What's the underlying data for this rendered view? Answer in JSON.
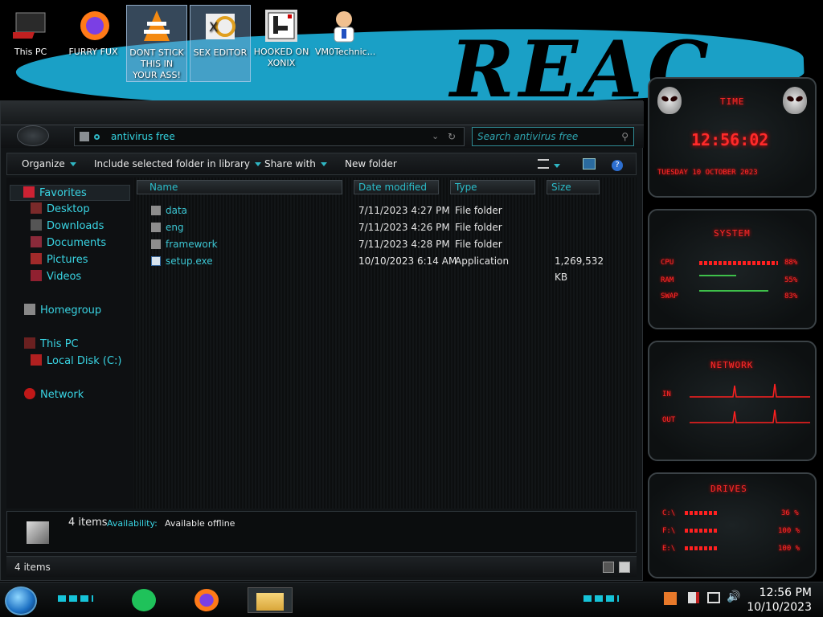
{
  "desktop": {
    "wallpaper_text": "REAC",
    "icons": [
      {
        "label": "This PC"
      },
      {
        "label": "FURRY FUX"
      },
      {
        "label": "DONT STICK THIS IN YOUR ASS!"
      },
      {
        "label": "SEX EDITOR"
      },
      {
        "label": "HOOKED ON XONIX"
      },
      {
        "label": "VM0Technic..."
      }
    ]
  },
  "explorer": {
    "address": "antivirus free",
    "search_placeholder": "Search antivirus free",
    "toolbar": {
      "organize": "Organize",
      "include_library": "Include selected folder in library",
      "share_with": "Share with",
      "new_folder": "New folder"
    },
    "nav": {
      "favorites": "Favorites",
      "desktop": "Desktop",
      "downloads": "Downloads",
      "documents": "Documents",
      "pictures": "Pictures",
      "videos": "Videos",
      "homegroup": "Homegroup",
      "this_pc": "This PC",
      "local_disk": "Local Disk (C:)",
      "network": "Network"
    },
    "columns": {
      "name": "Name",
      "date": "Date modified",
      "type": "Type",
      "size": "Size"
    },
    "files": [
      {
        "name": "data",
        "date": "7/11/2023 4:27 PM",
        "type": "File folder",
        "size": "",
        "icon": "folder-icon"
      },
      {
        "name": "eng",
        "date": "7/11/2023 4:26 PM",
        "type": "File folder",
        "size": "",
        "icon": "folder-icon"
      },
      {
        "name": "framework",
        "date": "7/11/2023 4:28 PM",
        "type": "File folder",
        "size": "",
        "icon": "folder-icon"
      },
      {
        "name": "setup.exe",
        "date": "10/10/2023 6:14 AM",
        "type": "Application",
        "size": "1,269,532 KB",
        "icon": "application-icon"
      }
    ],
    "details": {
      "count": "4 items",
      "availability_label": "Availability:",
      "availability_value": "Available offline"
    },
    "status": "4 items"
  },
  "widgets": {
    "time": {
      "title": "TIME",
      "clock": "12:56:02",
      "date": "TUESDAY 10 OCTOBER 2023"
    },
    "system": {
      "title": "SYSTEM",
      "cpu_label": "CPU",
      "cpu_value": "88%",
      "ram_label": "RAM",
      "ram_value": "55%",
      "swap_label": "SWAP",
      "swap_value": "83%"
    },
    "network": {
      "title": "NETWORK",
      "in_label": "IN",
      "out_label": "OUT"
    },
    "drives": {
      "title": "DRIVES",
      "c_label": "C:\\",
      "c_value": "36 %",
      "f_label": "F:\\",
      "f_value": "100 %",
      "e_label": "E:\\",
      "e_value": "100 %"
    }
  },
  "taskbar": {
    "time": "12:56 PM",
    "date": "10/10/2023"
  },
  "colors": {
    "accent_cyan": "#34d3e0",
    "widget_red": "#ff2a2a",
    "wallpaper_blue": "#1aa0c6"
  }
}
